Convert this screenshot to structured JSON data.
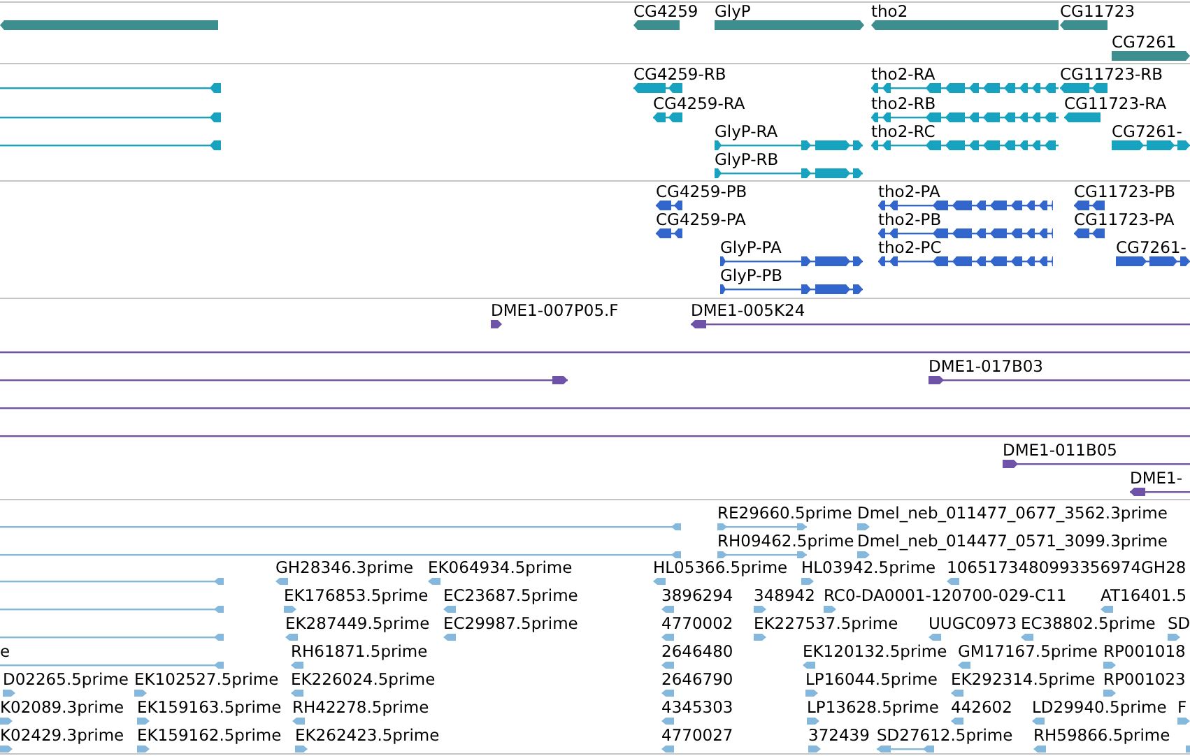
{
  "tracks": [
    {
      "kind": "gene",
      "color": "#3d8f8f",
      "features": [
        {
          "reverse": true
        },
        {
          "label": "CG4259",
          "reverse": true
        },
        {
          "label": "GlyP",
          "reverse": false
        },
        {
          "label": "tho2",
          "reverse": true
        },
        {
          "label": "CG11723",
          "reverse": true
        },
        {
          "label": "CG7261",
          "reverse": false
        }
      ]
    },
    {
      "kind": "transcript",
      "color": "#17a2c0",
      "features": [
        {
          "reverse": true
        },
        {
          "reverse": true
        },
        {
          "reverse": true
        },
        {
          "label": "CG4259-RB",
          "reverse": true
        },
        {
          "label": "CG4259-RA",
          "reverse": true
        },
        {
          "label": "GlyP-RA",
          "reverse": false
        },
        {
          "label": "GlyP-RB",
          "reverse": false
        },
        {
          "label": "tho2-RA",
          "reverse": true
        },
        {
          "label": "tho2-RB",
          "reverse": true
        },
        {
          "label": "tho2-RC",
          "reverse": true
        },
        {
          "label": "CG11723-RB",
          "reverse": true
        },
        {
          "label": "CG11723-RA",
          "reverse": true
        },
        {
          "label": "CG7261-",
          "reverse": false
        }
      ]
    },
    {
      "kind": "transcript",
      "color": "#3366cc",
      "features": [
        {
          "label": "CG4259-PB",
          "reverse": true
        },
        {
          "label": "CG4259-PA",
          "reverse": true
        },
        {
          "label": "GlyP-PA",
          "reverse": false
        },
        {
          "label": "GlyP-PB",
          "reverse": false
        },
        {
          "label": "tho2-PA",
          "reverse": true
        },
        {
          "label": "tho2-PB",
          "reverse": true
        },
        {
          "label": "tho2-PC",
          "reverse": true
        },
        {
          "label": "CG11723-PB",
          "reverse": true
        },
        {
          "label": "CG11723-PA",
          "reverse": true
        },
        {
          "label": "CG7261-",
          "reverse": false
        }
      ]
    },
    {
      "kind": "clone",
      "color": "#6f53a8",
      "features": [
        {
          "label": "DME1-007P05.F",
          "reverse": false
        },
        {
          "label": "DME1-005K24",
          "reverse": true
        },
        {
          "reverse": false
        },
        {
          "reverse": false
        },
        {
          "label": "DME1-017B03",
          "reverse": false
        },
        {
          "reverse": false
        },
        {
          "reverse": false
        },
        {
          "label": "DME1-011B05",
          "reverse": false
        },
        {
          "label": "DME1-",
          "reverse": true
        }
      ]
    },
    {
      "kind": "est",
      "color": "#85b8dd",
      "features": [
        {
          "reverse": true
        },
        {
          "reverse": true
        },
        {
          "reverse": true
        },
        {
          "reverse": true
        },
        {
          "reverse": true
        },
        {
          "label": "e",
          "reverse": true
        },
        {
          "label": "RE29660.5prime",
          "reverse": false
        },
        {
          "label": "Dmel_neb_011477_0677_3562.3prime",
          "reverse": false
        },
        {
          "label": "RH09462.5prime",
          "reverse": false
        },
        {
          "label": "Dmel_neb_014477_0571_3099.3prime",
          "reverse": false
        },
        {
          "label": "GH28346.3prime",
          "reverse": true
        },
        {
          "label": "EK064934.5prime",
          "reverse": true
        },
        {
          "label": "HL05366.5prime",
          "reverse": true
        },
        {
          "label": "HL03942.5prime",
          "reverse": false
        },
        {
          "label": "1065173480993356974GH28",
          "reverse": true
        },
        {
          "label": "EK176853.5prime",
          "reverse": false
        },
        {
          "label": "EC23687.5prime",
          "reverse": true
        },
        {
          "label": "3896294",
          "reverse": true
        },
        {
          "label": "348942",
          "reverse": false
        },
        {
          "label": "RC0-DA0001-120700-029-C11",
          "reverse": false
        },
        {
          "label": "AT16401.5",
          "reverse": true
        },
        {
          "label": "EK287449.5prime",
          "reverse": true
        },
        {
          "label": "EC29987.5prime",
          "reverse": true
        },
        {
          "label": "4770002",
          "reverse": true
        },
        {
          "label": "EK227537.5prime",
          "reverse": false
        },
        {
          "label": "UUGC0973",
          "reverse": true
        },
        {
          "label": "EC38802.5prime",
          "reverse": true
        },
        {
          "label": "SD",
          "reverse": false
        },
        {
          "label": "RH61871.5prime",
          "reverse": true
        },
        {
          "label": "2646480",
          "reverse": true
        },
        {
          "label": "EK120132.5prime",
          "reverse": true
        },
        {
          "label": "GM17167.5prime",
          "reverse": true
        },
        {
          "label": "RP001018",
          "reverse": false
        },
        {
          "label": "D02265.5prime",
          "reverse": false
        },
        {
          "label": "EK102527.5prime",
          "reverse": false
        },
        {
          "label": "EK226024.5prime",
          "reverse": true
        },
        {
          "label": "2646790",
          "reverse": true
        },
        {
          "label": "LP16044.5prime",
          "reverse": false
        },
        {
          "label": "EK292314.5prime",
          "reverse": true
        },
        {
          "label": "RP001023",
          "reverse": false
        },
        {
          "label": "K02089.3prime",
          "reverse": false
        },
        {
          "label": "EK159163.5prime",
          "reverse": false
        },
        {
          "label": "RH42278.5prime",
          "reverse": true
        },
        {
          "label": "4345303",
          "reverse": true
        },
        {
          "label": "LP13628.5prime",
          "reverse": false
        },
        {
          "label": "442602",
          "reverse": true
        },
        {
          "label": "LD29940.5prime",
          "reverse": true
        },
        {
          "label": "F",
          "reverse": false
        },
        {
          "label": "K02429.3prime",
          "reverse": false
        },
        {
          "label": "EK159162.5prime",
          "reverse": false
        },
        {
          "label": "EK262423.5prime",
          "reverse": false
        },
        {
          "label": "4770027",
          "reverse": true
        },
        {
          "label": "372439",
          "reverse": false
        },
        {
          "label": "SD27612.5prime",
          "reverse": true
        },
        {
          "label": "RH59866.5prime",
          "reverse": true
        },
        {
          "reverse": false
        }
      ]
    }
  ]
}
